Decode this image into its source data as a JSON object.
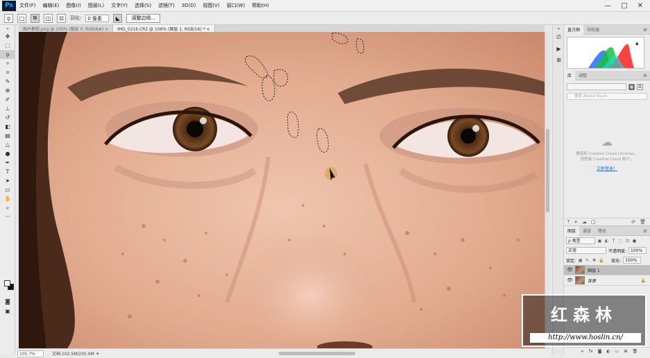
{
  "app": {
    "logo": "Ps"
  },
  "menu": [
    "文件(F)",
    "编辑(E)",
    "图像(I)",
    "图层(L)",
    "文字(Y)",
    "选择(S)",
    "滤镜(T)",
    "3D(D)",
    "视图(V)",
    "窗口(W)",
    "帮助(H)"
  ],
  "window_controls": {
    "minimize": "—",
    "maximize": "□",
    "close": "✕"
  },
  "options": {
    "feather_label": "羽化:",
    "feather_value": "0 像素",
    "refine_edge": "调整边缘..."
  },
  "tabs": [
    {
      "label": "图片教程.png @ 100% (图层 0, RGB/8#) ×"
    },
    {
      "label": "IMG_0216.CR2 @ 106% (图层 1, RGB/16) * ×"
    }
  ],
  "status": {
    "zoom": "105.7%",
    "doc": "文档:102.5M/205.0M"
  },
  "panels": {
    "histogram_tabs": [
      "直方图",
      "导航器"
    ],
    "library_tabs": [
      "库",
      "调整"
    ],
    "library_search_placeholder": "搜索 Adobe Stock",
    "cc_message_line1": "要使用 Creative Cloud Libraries，",
    "cc_message_line2": "请登录 Creative Cloud 帐户。",
    "cc_login": "立即登录！",
    "layers_tabs": [
      "图层",
      "通道",
      "路径"
    ],
    "filter_kind": "ρ 类型",
    "blend_mode": "正常",
    "opacity_label": "不透明度:",
    "opacity_value": "100%",
    "lock_label": "锁定:",
    "fill_label": "填充:",
    "fill_value": "100%",
    "layers": [
      {
        "name": "图层 1",
        "selected": true
      },
      {
        "name": "背景",
        "selected": false
      }
    ]
  },
  "watermark": {
    "title": "红森林",
    "url": "http://www.hoslin.cn/"
  },
  "colors": {
    "accent": "#31a8ff",
    "link": "#1473e6"
  }
}
